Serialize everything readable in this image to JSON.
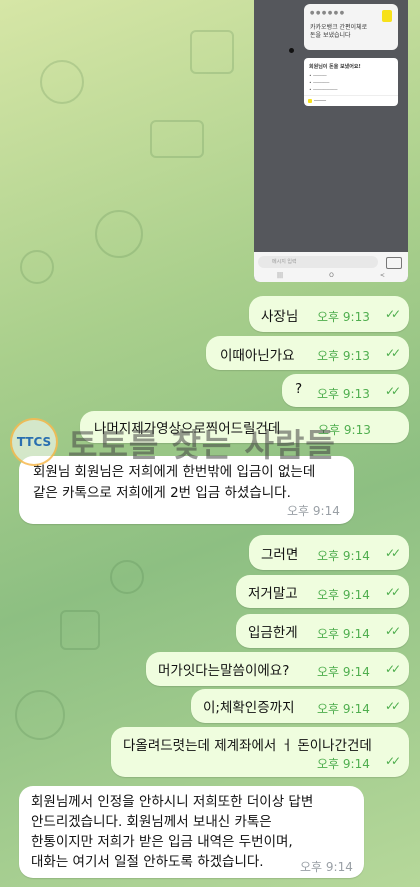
{
  "watermark": {
    "logo": "TTCS",
    "text": "토토를 찾는 사람들"
  },
  "screenshot": {
    "card_text": "카카오뱅크 간편이체로\n돈을 보냈습니다",
    "card2_title": "회원님이 돈을 보냈어요!",
    "input_placeholder": "메시지 입력",
    "navbar": [
      "|||",
      "O",
      "<"
    ]
  },
  "messages": [
    {
      "side": "out",
      "text": "사장님",
      "time": "오후 9:13"
    },
    {
      "side": "out",
      "text": "이때아닌가요",
      "time": "오후 9:13"
    },
    {
      "side": "out",
      "text": "?",
      "time": "오후 9:13"
    },
    {
      "side": "out",
      "text": "나머지제가영상으로찍어드릴건데",
      "time": "오후 9:13"
    },
    {
      "side": "in",
      "text": "회원님 회원님은 저희에게 한번밖에 입금이 없는데\n같은 카톡으로 저희에게 2번 입금 하셨습니다.",
      "time": "오후 9:14"
    },
    {
      "side": "out",
      "text": "그러면",
      "time": "오후 9:14"
    },
    {
      "side": "out",
      "text": "저거말고",
      "time": "오후 9:14"
    },
    {
      "side": "out",
      "text": "입금한게",
      "time": "오후 9:14"
    },
    {
      "side": "out",
      "text": "머가잇다는말씀이에요?",
      "time": "오후 9:14"
    },
    {
      "side": "out",
      "text": "이;체확인증까지",
      "time": "오후 9:14"
    },
    {
      "side": "out",
      "text": "다올려드렷는데 제계좌에서 ㅓ 돈이나간건데",
      "time": "오후 9:14"
    },
    {
      "side": "in",
      "text": "회원님께서 인정을 안하시니 저희또한 더이상 답변\n안드리겠습니다. 회원님께서 보내신 카톡은\n한통이지만 저희가 받은 입금 내역은 두번이며,\n대화는 여기서 일절 안하도록 하겠습니다.",
      "time": "오후 9:14"
    }
  ]
}
